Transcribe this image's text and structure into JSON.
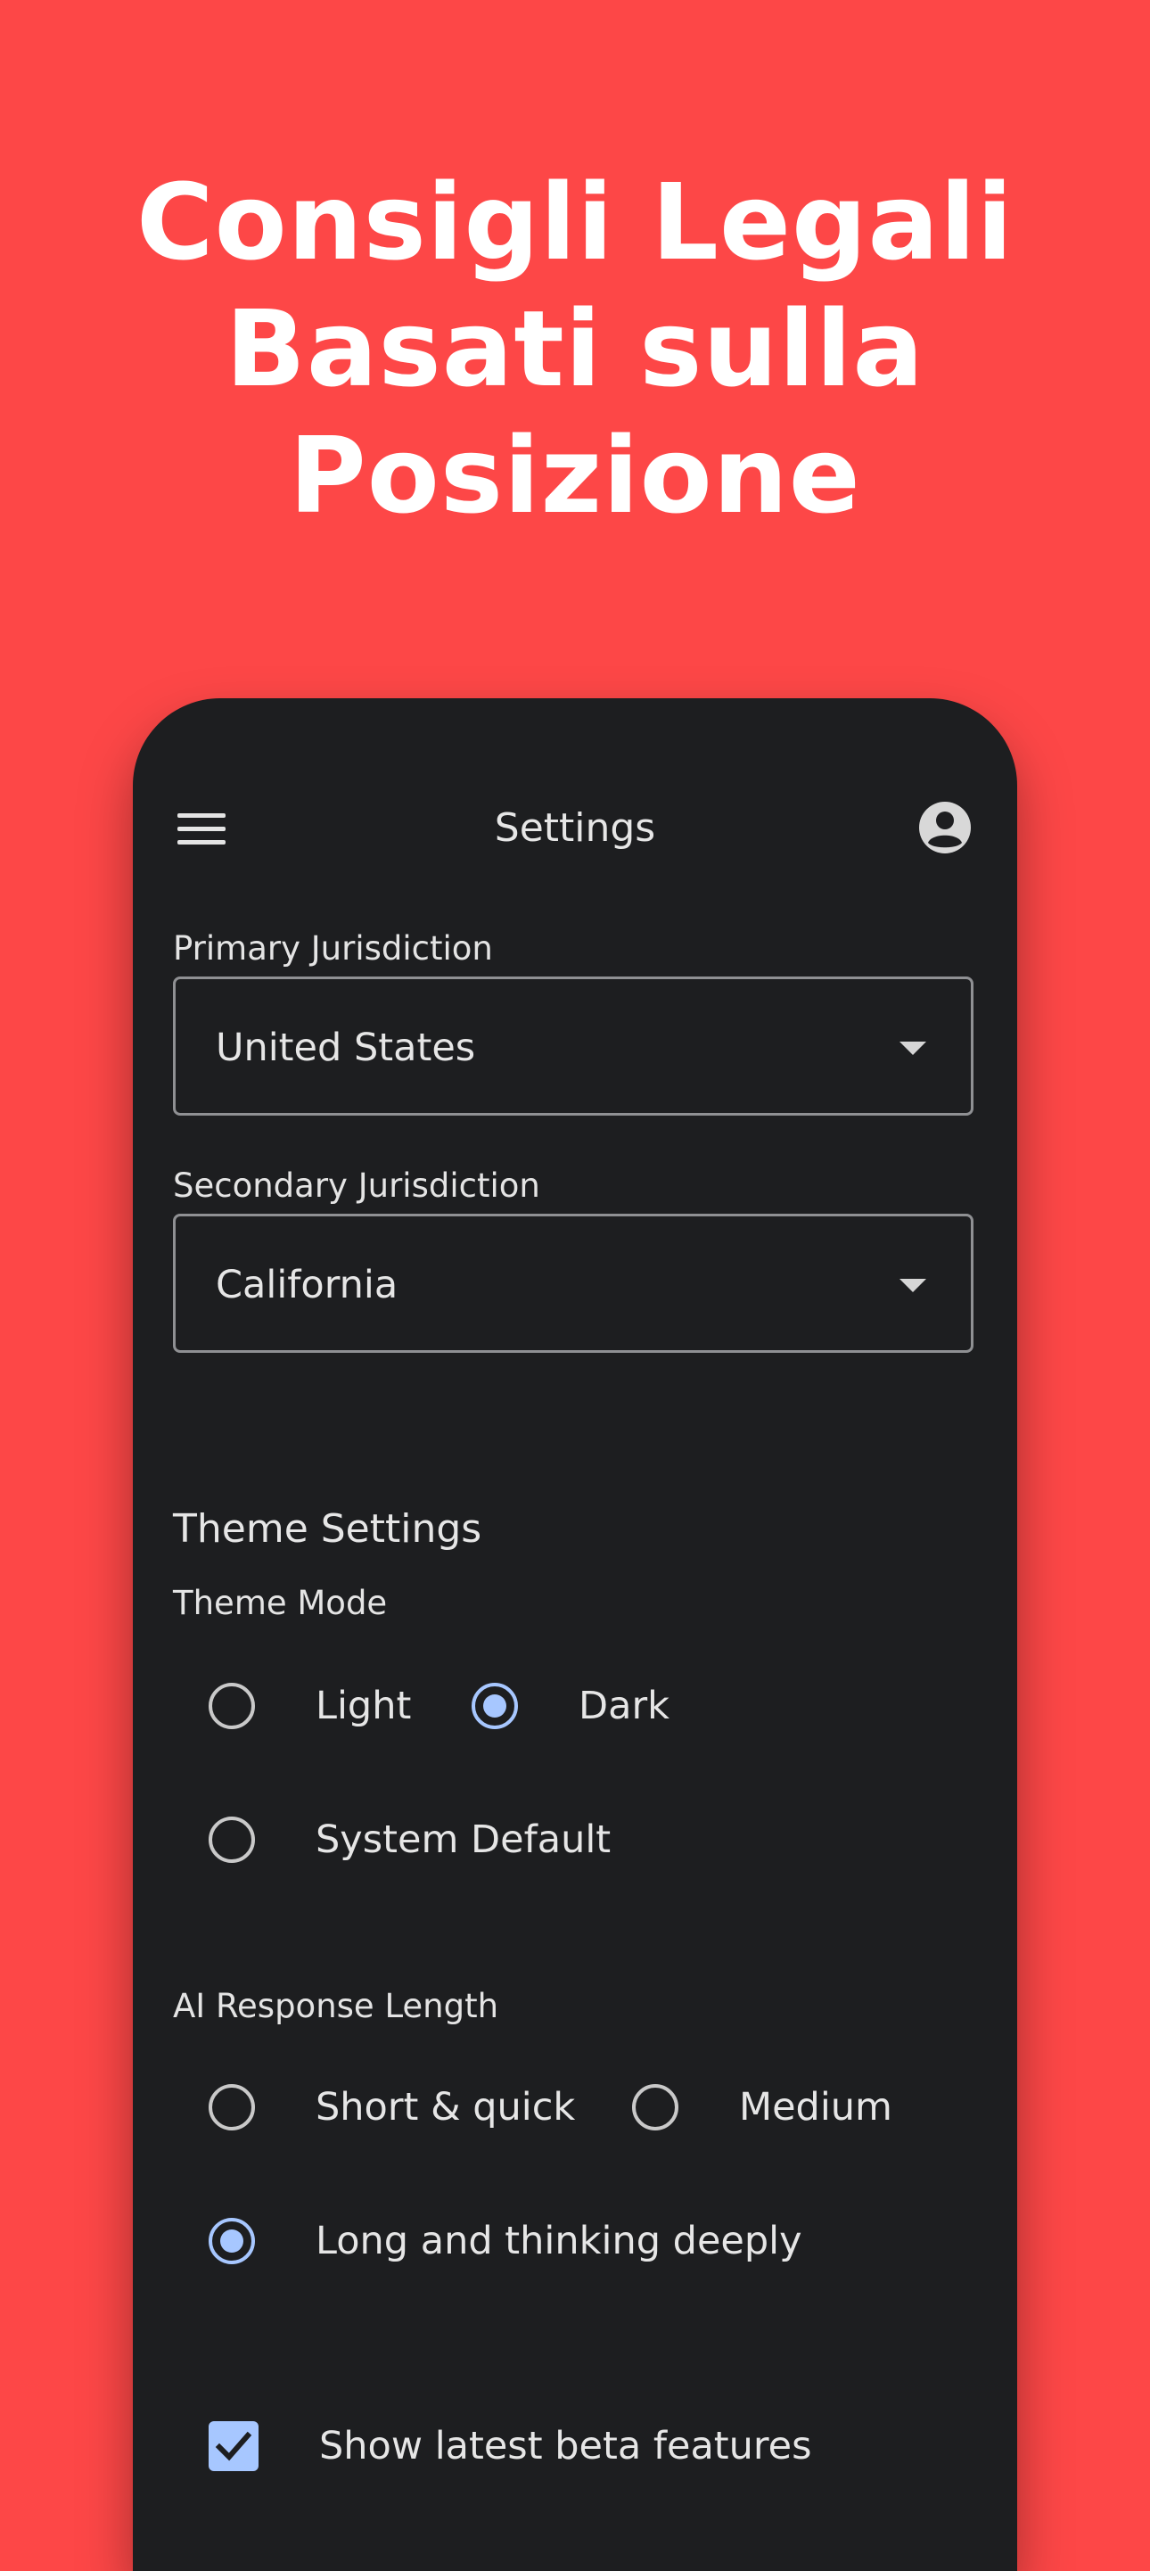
{
  "headline": {
    "line1": "Consigli Legali",
    "line2": "Basati sulla",
    "line3": "Posizione"
  },
  "colors": {
    "background": "#fd4747",
    "surface": "#1d1e20",
    "accent": "#a7c7ff"
  },
  "appbar": {
    "title": "Settings",
    "menu_icon": "hamburger-menu-icon",
    "account_icon": "account-circle-icon"
  },
  "jurisdiction": {
    "primary_label": "Primary Jurisdiction",
    "primary_value": "United States",
    "secondary_label": "Secondary Jurisdiction",
    "secondary_value": "California"
  },
  "theme": {
    "section_title": "Theme Settings",
    "mode_label": "Theme Mode",
    "options": [
      "Light",
      "Dark",
      "System Default"
    ],
    "selected": "Dark"
  },
  "ai_response": {
    "label": "AI Response Length",
    "options": [
      "Short & quick",
      "Medium",
      "Long and thinking deeply"
    ],
    "selected": "Long and thinking deeply"
  },
  "beta": {
    "label": "Show latest beta features",
    "checked": true
  }
}
